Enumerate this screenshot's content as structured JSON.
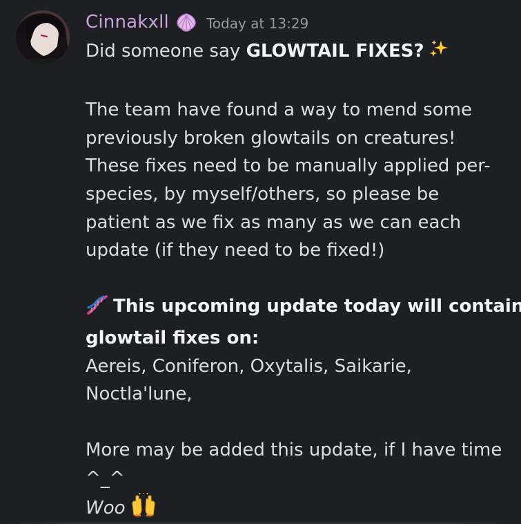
{
  "message": {
    "author": "Cinnakxll",
    "role_icon": "shell-icon",
    "timestamp": "Today at 13:29",
    "accent_color": "#c9a0dc",
    "intro_prefix": "Did someone say ",
    "intro_bold": "GLOWTAIL FIXES?",
    "intro_emoji": "sparkles-icon",
    "paragraph_lines": [
      "The team have found a way to mend some",
      "previously broken glowtails on creatures!",
      "These fixes need to be manually applied per-",
      "species, by myself/others, so please be",
      "patient as we fix as many as we can each",
      "update (if they need to be fixed!)"
    ],
    "dna_emoji": "dna-icon",
    "bold_lines": [
      "This upcoming update today will contain",
      "glowtail fixes on:"
    ],
    "species_lines": [
      "Aereis, Coniferon, Oxytalis, Saikarie,",
      "Noctla'lune,"
    ],
    "more_lines": [
      "More may be added this update, if I have time",
      "^_^"
    ],
    "closing_text": "Woo",
    "closing_emoji": "raised-hands-icon"
  }
}
